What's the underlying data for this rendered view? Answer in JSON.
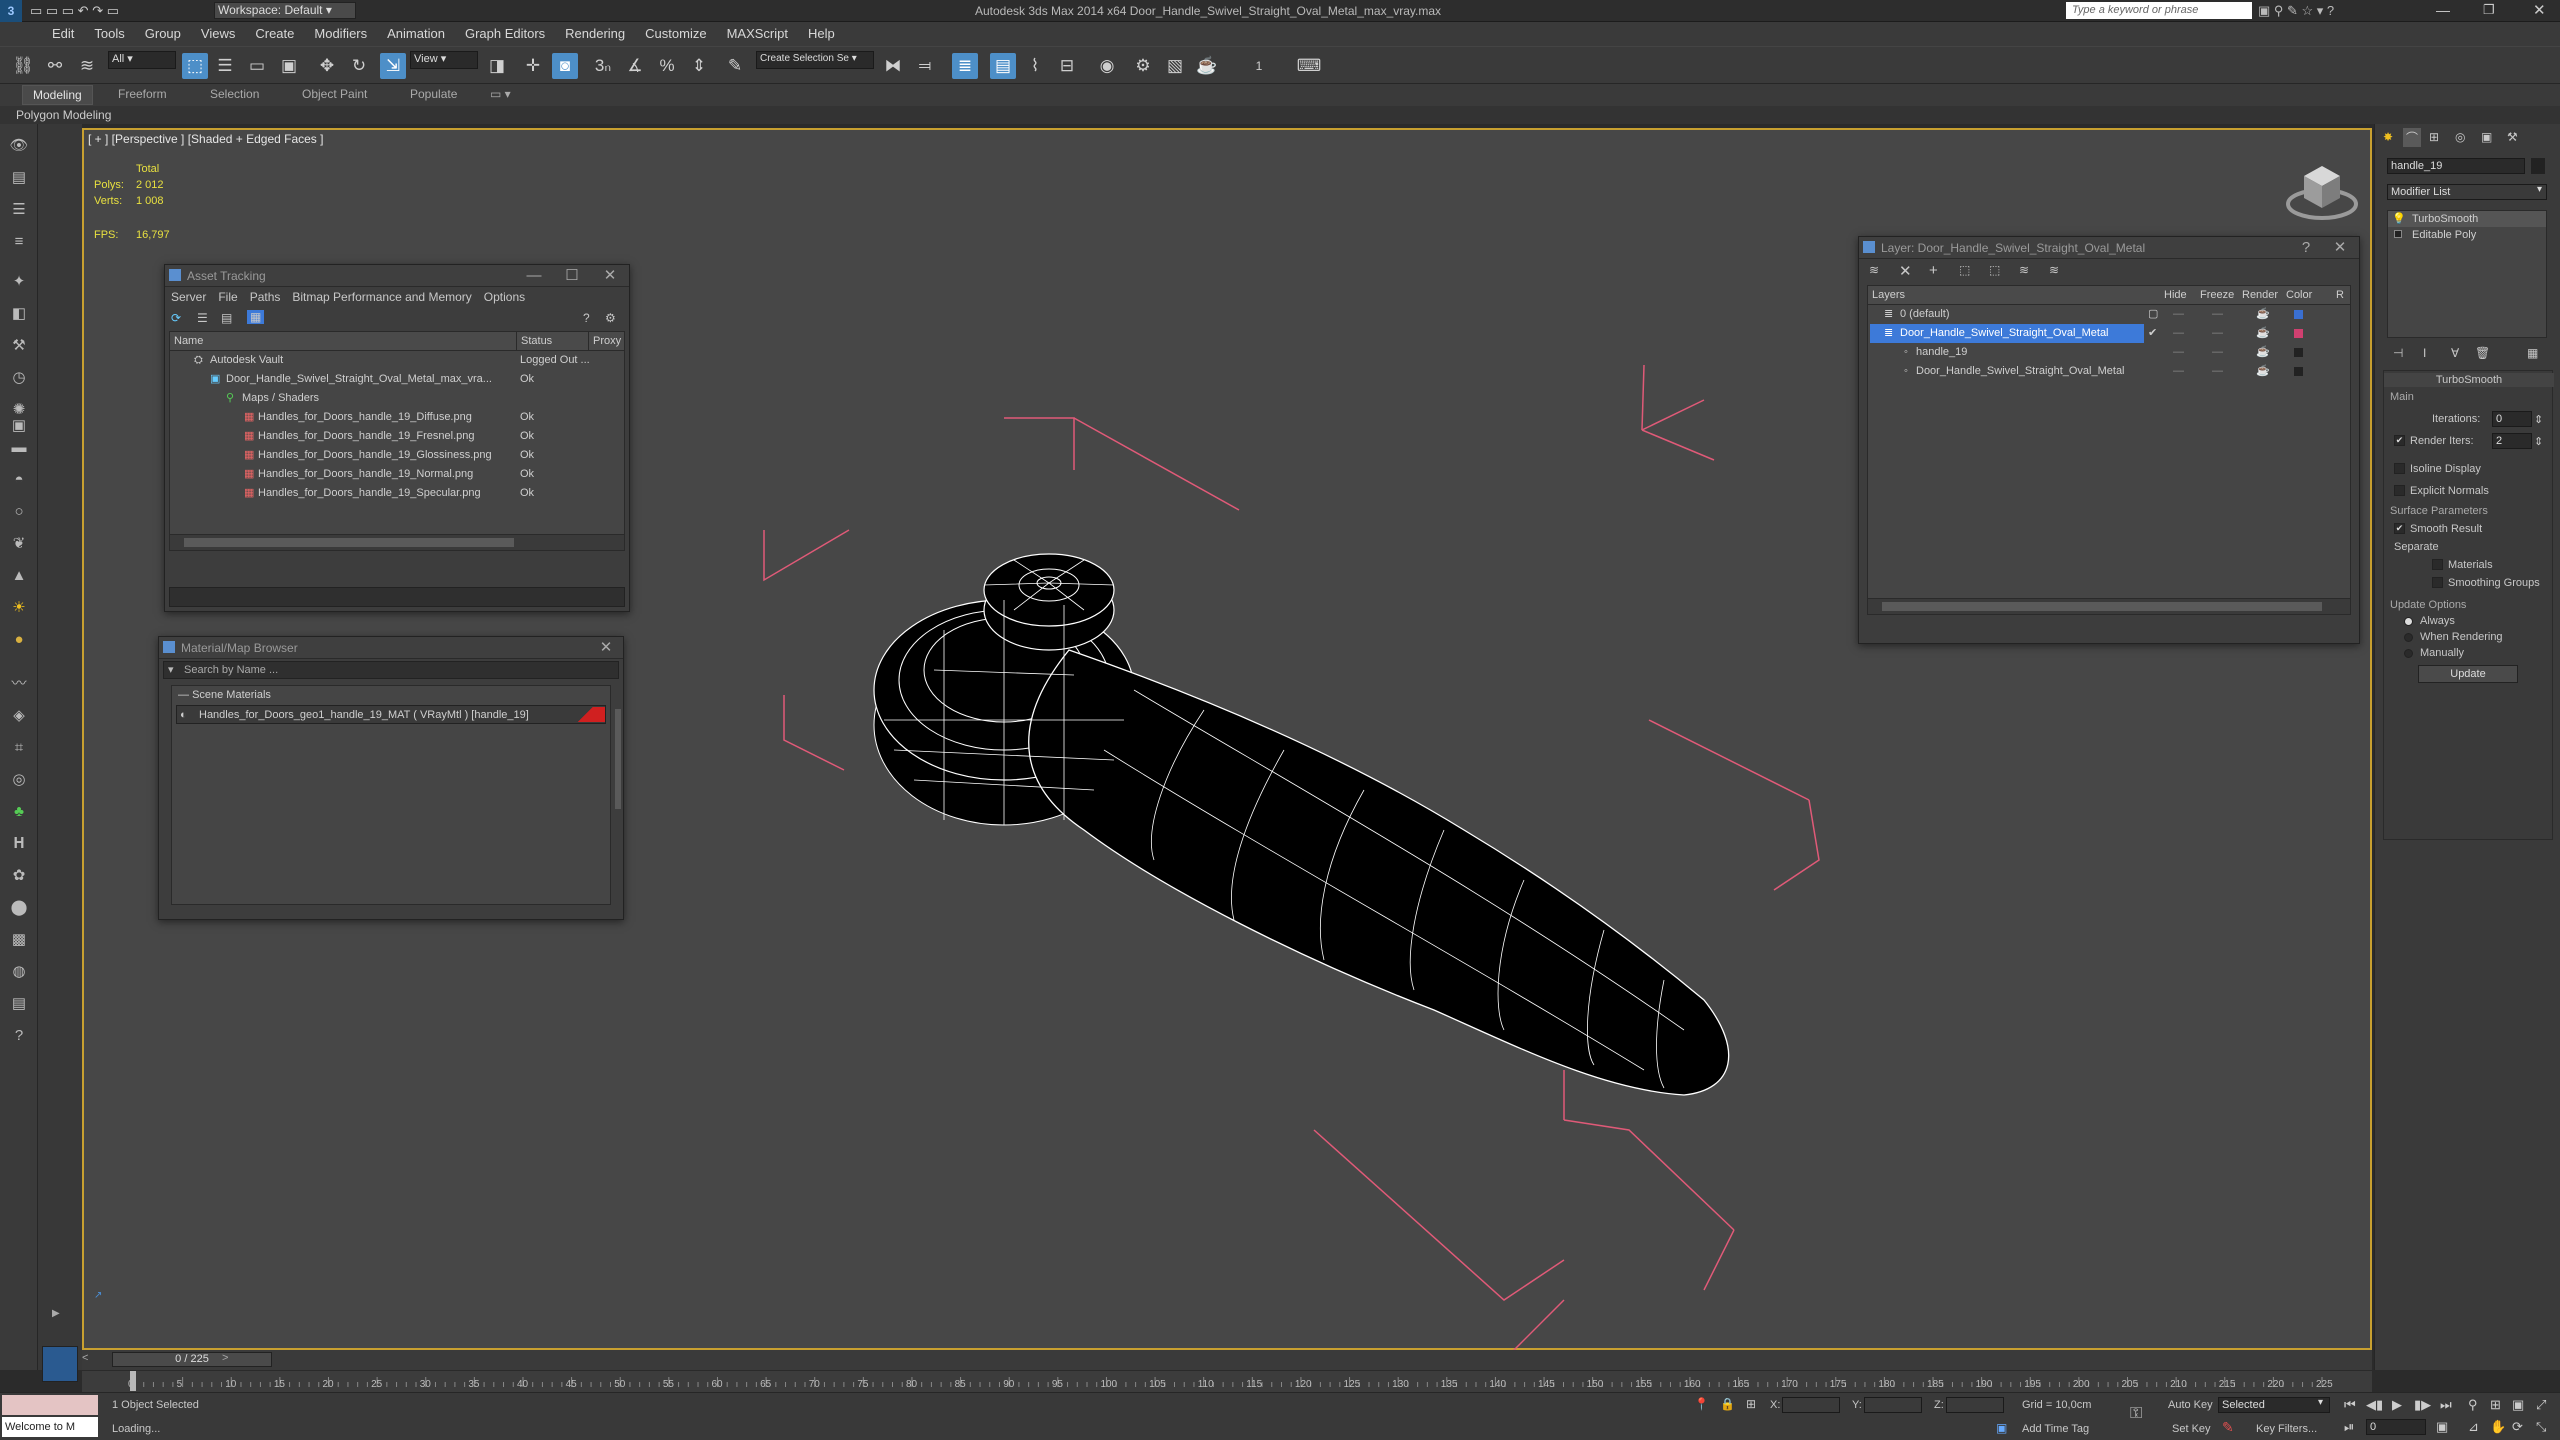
{
  "titlebar": {
    "workspace": "Workspace: Default",
    "title": "Autodesk 3ds Max 2014 x64    Door_Handle_Swivel_Straight_Oval_Metal_max_vray.max",
    "search_placeholder": "Type a keyword or phrase"
  },
  "menu": [
    "Edit",
    "Tools",
    "Group",
    "Views",
    "Create",
    "Modifiers",
    "Animation",
    "Graph Editors",
    "Rendering",
    "Customize",
    "MAXScript",
    "Help"
  ],
  "toolbar": {
    "filter": "All",
    "view": "View",
    "selection_set": "Create Selection Se"
  },
  "ribbon": {
    "tabs": [
      "Modeling",
      "Freeform",
      "Selection",
      "Object Paint",
      "Populate"
    ],
    "sub": "Polygon Modeling"
  },
  "viewport": {
    "label": "[ + ] [Perspective ] [Shaded + Edged Faces ]",
    "total": "Total",
    "polys_label": "Polys:",
    "polys": "2 012",
    "verts_label": "Verts:",
    "verts": "1 008",
    "fps_label": "FPS:",
    "fps": "16,797"
  },
  "asset_tracking": {
    "title": "Asset Tracking",
    "menu": [
      "Server",
      "File",
      "Paths",
      "Bitmap Performance and Memory",
      "Options"
    ],
    "columns": [
      "Name",
      "Status",
      "Proxy"
    ],
    "rows": [
      {
        "name": "Autodesk Vault",
        "status": "Logged Out ..."
      },
      {
        "name": "Door_Handle_Swivel_Straight_Oval_Metal_max_vra...",
        "status": "Ok"
      },
      {
        "name": "Maps / Shaders",
        "status": ""
      },
      {
        "name": "Handles_for_Doors_handle_19_Diffuse.png",
        "status": "Ok"
      },
      {
        "name": "Handles_for_Doors_handle_19_Fresnel.png",
        "status": "Ok"
      },
      {
        "name": "Handles_for_Doors_handle_19_Glossiness.png",
        "status": "Ok"
      },
      {
        "name": "Handles_for_Doors_handle_19_Normal.png",
        "status": "Ok"
      },
      {
        "name": "Handles_for_Doors_handle_19_Specular.png",
        "status": "Ok"
      }
    ]
  },
  "material_browser": {
    "title": "Material/Map Browser",
    "search_placeholder": "Search by Name ...",
    "section": "Scene Materials",
    "item": "Handles_for_Doors_geo1_handle_19_MAT ( VRayMtl ) [handle_19]"
  },
  "layer_window": {
    "title": "Layer: Door_Handle_Swivel_Straight_Oval_Metal",
    "columns": [
      "Layers",
      "Hide",
      "Freeze",
      "Render",
      "Color",
      "R"
    ],
    "rows": [
      {
        "name": "0 (default)",
        "color": "#3a6fd0"
      },
      {
        "name": "Door_Handle_Swivel_Straight_Oval_Metal",
        "color": "#d04070"
      },
      {
        "name": "handle_19",
        "color": "#222222"
      },
      {
        "name": "Door_Handle_Swivel_Straight_Oval_Metal",
        "color": "#222222"
      }
    ]
  },
  "command_panel": {
    "object_name": "handle_19",
    "modifier_list": "Modifier List",
    "stack": [
      "TurboSmooth",
      "Editable Poly"
    ],
    "rollout": "TurboSmooth",
    "main": "Main",
    "iterations_label": "Iterations:",
    "iterations": "0",
    "render_iters_label": "Render Iters:",
    "render_iters": "2",
    "isoline": "Isoline Display",
    "explicit": "Explicit Normals",
    "surface": "Surface Parameters",
    "smooth_result": "Smooth Result",
    "separate": "Separate",
    "materials": "Materials",
    "smoothing_groups": "Smoothing Groups",
    "update_options": "Update Options",
    "always": "Always",
    "when_rendering": "When Rendering",
    "manually": "Manually",
    "update": "Update"
  },
  "timeline": {
    "frame": "0 / 225"
  },
  "ruler_ticks": [
    "0",
    "5",
    "10",
    "15",
    "20",
    "25",
    "30",
    "35",
    "40",
    "45",
    "50",
    "55",
    "60",
    "65",
    "70",
    "75",
    "80",
    "85",
    "90",
    "95",
    "100",
    "105",
    "110",
    "115",
    "120",
    "125",
    "130",
    "135",
    "140",
    "145",
    "150",
    "155",
    "160",
    "165",
    "170",
    "175",
    "180",
    "185",
    "190",
    "195",
    "200",
    "205",
    "210",
    "215",
    "220",
    "225"
  ],
  "status": {
    "welcome": "Welcome to M",
    "selected": "1 Object Selected",
    "loading": "Loading...",
    "x": "X:",
    "y": "Y:",
    "z": "Z:",
    "grid": "Grid = 10,0cm",
    "add_time_tag": "Add Time Tag",
    "auto_key": "Auto Key",
    "set_key": "Set Key",
    "selected_dd": "Selected",
    "key_filters": "Key Filters...",
    "frame_field": "0"
  }
}
